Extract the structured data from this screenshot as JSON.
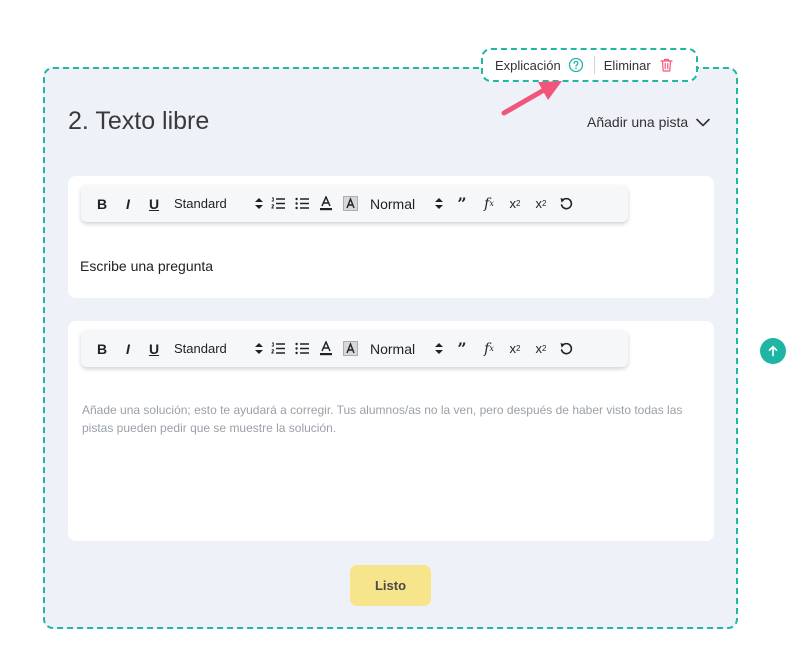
{
  "topbar": {
    "explanation_label": "Explicación",
    "delete_label": "Eliminar"
  },
  "question": {
    "title": "2. Texto libre",
    "hint_label": "Añadir una pista"
  },
  "toolbar": {
    "size_label": "Standard",
    "header_label": "Normal"
  },
  "question_editor": {
    "text": "Escribe una pregunta"
  },
  "solution_editor": {
    "placeholder": "Añade una solución; esto te ayudará a corregir. Tus alumnos/as no la ven, pero después de haber visto todas las pistas pueden pedir que se muestre la solución."
  },
  "actions": {
    "done_label": "Listo"
  },
  "colors": {
    "accent": "#22b7a3",
    "card_bg": "#eef1f7",
    "done_button": "#f7e58b",
    "delete": "#f2557a",
    "arrow": "#f2557a"
  }
}
